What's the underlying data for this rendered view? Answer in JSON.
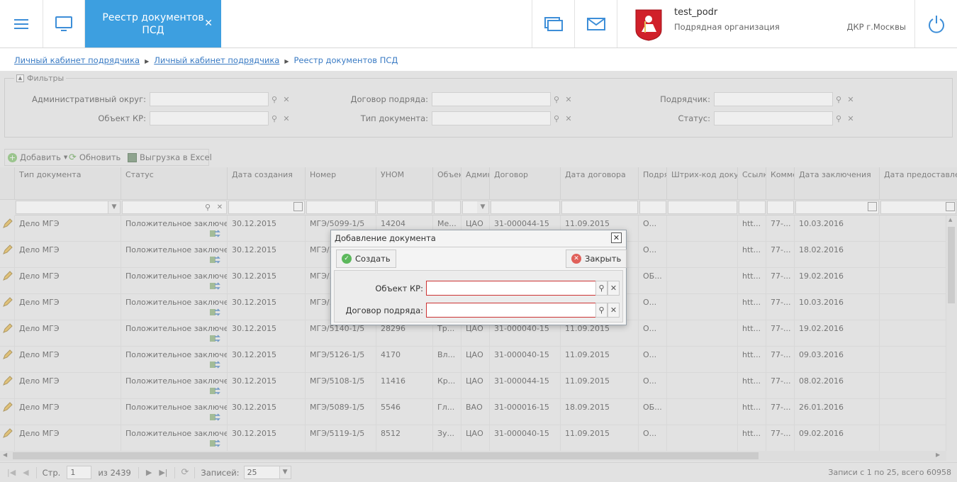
{
  "header": {
    "tab_title": "Реестр документов ПСД",
    "user_name": "test_podr",
    "user_role": "Подрядная организация",
    "org": "ДКР г.Москвы"
  },
  "breadcrumb": [
    "Личный кабинет подрядчика",
    "Личный кабинет подрядчика",
    "Реестр документов ПСД"
  ],
  "filters": {
    "legend": "Фильтры",
    "items": [
      {
        "label": "Административный округ:"
      },
      {
        "label": "Объект КР:"
      },
      {
        "label": "Договор подряда:"
      },
      {
        "label": "Тип документа:"
      },
      {
        "label": "Подрядчик:"
      },
      {
        "label": "Статус:"
      }
    ]
  },
  "toolbar": {
    "add": "Добавить",
    "refresh": "Обновить",
    "export": "Выгрузка в Excel"
  },
  "columns": [
    "Тип документа",
    "Статус",
    "Дата создания",
    "Номер",
    "УНОМ",
    "Объект",
    "Административный",
    "Договор",
    "Дата договора",
    "Подрядчик",
    "Штрих-код документа",
    "Ссылка",
    "Комментарий",
    "Дата заключения",
    "Дата предоставления"
  ],
  "rows": [
    [
      "Дело МГЭ",
      "Положительное заключение",
      "30.12.2015",
      "МГЭ/5099-1/5",
      "14204",
      "Ме...",
      "ЦАО",
      "31-000044-15",
      "11.09.2015",
      "О...",
      "",
      "htt...",
      "77-...",
      "10.03.2016"
    ],
    [
      "Дело МГЭ",
      "Положительное заключение",
      "30.12.2015",
      "МГЭ/...",
      "",
      "",
      "",
      "",
      "",
      "О...",
      "",
      "htt...",
      "77-...",
      "18.02.2016"
    ],
    [
      "Дело МГЭ",
      "Положительное заключение",
      "30.12.2015",
      "МГЭ/...",
      "",
      "",
      "",
      "",
      "",
      "ОБ...",
      "",
      "htt...",
      "77-...",
      "19.02.2016"
    ],
    [
      "Дело МГЭ",
      "Положительное заключение",
      "30.12.2015",
      "МГЭ/...",
      "",
      "",
      "",
      "",
      "",
      "О...",
      "",
      "htt...",
      "77-...",
      "10.03.2016"
    ],
    [
      "Дело МГЭ",
      "Положительное заключение",
      "30.12.2015",
      "МГЭ/5140-1/5",
      "28296",
      "Тр...",
      "ЦАО",
      "31-000040-15",
      "11.09.2015",
      "О...",
      "",
      "htt...",
      "77-...",
      "19.02.2016"
    ],
    [
      "Дело МГЭ",
      "Положительное заключение",
      "30.12.2015",
      "МГЭ/5126-1/5",
      "4170",
      "Вл...",
      "ЦАО",
      "31-000040-15",
      "11.09.2015",
      "О...",
      "",
      "htt...",
      "77-...",
      "09.03.2016"
    ],
    [
      "Дело МГЭ",
      "Положительное заключение",
      "30.12.2015",
      "МГЭ/5108-1/5",
      "11416",
      "Кр...",
      "ЦАО",
      "31-000044-15",
      "11.09.2015",
      "О...",
      "",
      "htt...",
      "77-...",
      "08.02.2016"
    ],
    [
      "Дело МГЭ",
      "Положительное заключение",
      "30.12.2015",
      "МГЭ/5089-1/5",
      "5546",
      "Гл...",
      "ВАО",
      "31-000016-15",
      "18.09.2015",
      "ОБ...",
      "",
      "htt...",
      "77-...",
      "26.01.2016"
    ],
    [
      "Дело МГЭ",
      "Положительное заключение",
      "30.12.2015",
      "МГЭ/5119-1/5",
      "8512",
      "Зу...",
      "ЦАО",
      "31-000040-15",
      "11.09.2015",
      "О...",
      "",
      "htt...",
      "77-...",
      "09.02.2016"
    ]
  ],
  "pager": {
    "page_label": "Стр.",
    "page": "1",
    "of": "из 2439",
    "per_page_label": "Записей:",
    "per_page": "25",
    "summary": "Записи с 1 по 25, всего 60958"
  },
  "dialog": {
    "title": "Добавление документа",
    "create": "Создать",
    "close": "Закрыть",
    "field1": "Объект КР:",
    "field2": "Договор подряда:"
  }
}
